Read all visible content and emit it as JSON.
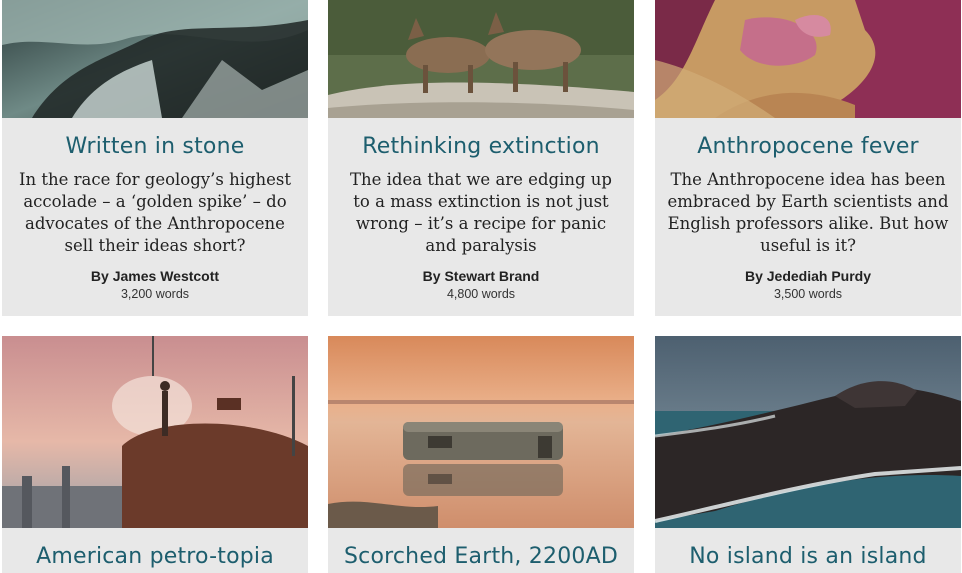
{
  "articles": [
    {
      "title": "Written in stone",
      "description": "In the race for geology’s highest accolade – a ‘golden spike’ – do advocates of the Anthropocene sell their ideas short?",
      "by_prefix": "By",
      "author": "James Westcott",
      "word_count": "3,200 words",
      "image": "ice-cave-photo"
    },
    {
      "title": "Rethinking extinction",
      "description": "The idea that we are edging up to a mass extinction is not just wrong – it’s a recipe for panic and paralysis",
      "by_prefix": "By",
      "author": "Stewart Brand",
      "word_count": "4,800 words",
      "image": "wolves-photo"
    },
    {
      "title": "Anthropocene fever",
      "description": "The Anthropocene idea has been embraced by Earth scientists and English professors alike. But how useful is it?",
      "by_prefix": "By",
      "author": "Jedediah Purdy",
      "word_count": "3,500 words",
      "image": "aerial-salt-ponds-photo"
    },
    {
      "title": "American petro-topia",
      "image": "refinery-worker-photo"
    },
    {
      "title": "Scorched Earth, 2200AD",
      "image": "flooded-caravan-photo"
    },
    {
      "title": "No island is an island",
      "image": "volcanic-island-photo"
    }
  ],
  "colors": {
    "title": "#1d5e6e",
    "card_background": "#e8e8e8"
  }
}
